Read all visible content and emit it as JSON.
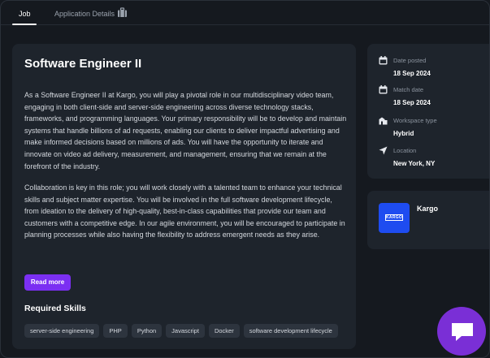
{
  "tabs": [
    {
      "label": "Job",
      "active": true
    },
    {
      "label": "Application Details",
      "active": false
    }
  ],
  "job": {
    "title": "Software Engineer II",
    "paragraphs": [
      "As a Software Engineer II at Kargo, you will play a pivotal role in our multidisciplinary video team, engaging in both client-side and server-side engineering across diverse technology stacks, frameworks, and programming languages. Your primary responsibility will be to develop and maintain systems that handle billions of ad requests, enabling our clients to deliver impactful advertising and make informed decisions based on millions of ads. You will have the opportunity to iterate and innovate on video ad delivery, measurement, and management, ensuring that we remain at the forefront of the industry.",
      "Collaboration is key in this role; you will work closely with a talented team to enhance your technical skills and subject matter expertise. You will be involved in the full software development lifecycle, from ideation to the delivery of high-quality, best-in-class capabilities that provide our team and customers with a competitive edge. In our agile environment, you will be encouraged to participate in planning processes while also having the flexibility to address emergent needs as they arise."
    ],
    "read_more_label": "Read more",
    "skills_heading": "Required Skills",
    "skills": [
      "server-side engineering",
      "PHP",
      "Python",
      "Javascript",
      "Docker",
      "software development lifecycle"
    ]
  },
  "info": {
    "date_posted_label": "Date posted",
    "date_posted": "18 Sep 2024",
    "match_date_label": "Match date",
    "match_date": "18 Sep 2024",
    "workspace_label": "Workspace type",
    "workspace": "Hybrid",
    "location_label": "Location",
    "location": "New York, NY"
  },
  "company": {
    "name": "Kargo",
    "logo_text": "KARGO",
    "logo_color": "#1e4cf0"
  },
  "colors": {
    "accent": "#7b2ff2",
    "chat": "#7a2fd6",
    "card": "#1e242c",
    "background": "#15191f"
  },
  "icons": {
    "briefcase": "briefcase-icon",
    "calendar": "calendar-icon",
    "building": "building-icon",
    "location": "location-arrow-icon",
    "chat": "chat-bubble-icon"
  }
}
